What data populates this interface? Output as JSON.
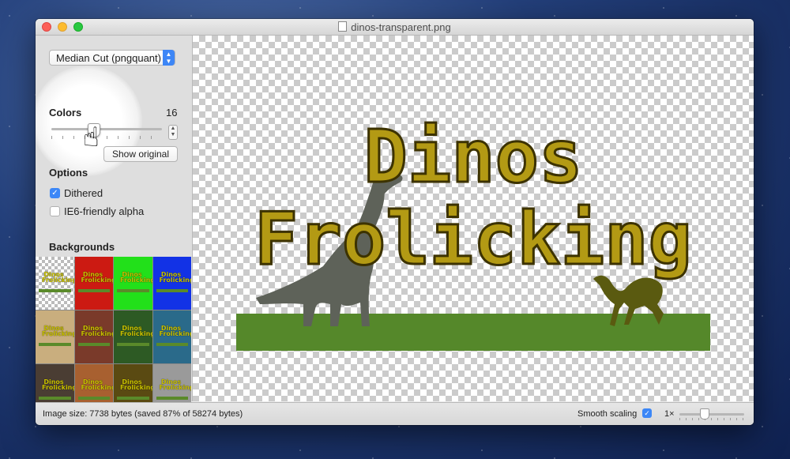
{
  "window": {
    "title": "dinos-transparent.png"
  },
  "sidebar": {
    "algorithm_select": "Median Cut (pngquant)",
    "colors_heading": "Colors",
    "colors_value": "16",
    "show_original_button": "Show original",
    "options_heading": "Options",
    "options": [
      {
        "label": "Dithered",
        "checked": true
      },
      {
        "label": "IE6-friendly alpha",
        "checked": false
      }
    ],
    "backgrounds_heading": "Backgrounds",
    "backgrounds": [
      {
        "fill": "#c8c8c8"
      },
      {
        "fill": "#cc1a12"
      },
      {
        "fill": "#22e01a"
      },
      {
        "fill": "#1232e6"
      },
      {
        "fill": "#c9ae7e"
      },
      {
        "fill": "#7a3a2a"
      },
      {
        "fill": "#2d5a24"
      },
      {
        "fill": "#2a6a8a"
      },
      {
        "fill": "#4a3d33"
      },
      {
        "fill": "#a86030"
      },
      {
        "fill": "#5a4a12"
      },
      {
        "fill": "#9a9a9a"
      }
    ],
    "tile_text": "Dinos Frolicking"
  },
  "canvas": {
    "title_line1": "Dinos",
    "title_line2": "Frolicking"
  },
  "statusbar": {
    "image_size": "Image size: 7738 bytes (saved 87% of 58274 bytes)",
    "smooth_scaling_label": "Smooth scaling",
    "smooth_scaling_checked": true,
    "zoom_label": "1×"
  },
  "colors": {
    "accent": "#3c87f7",
    "title_fill": "#b39a14",
    "grass": "#55882a",
    "dino_grey": "#5e6259",
    "dino_olive": "#5a5a10"
  }
}
